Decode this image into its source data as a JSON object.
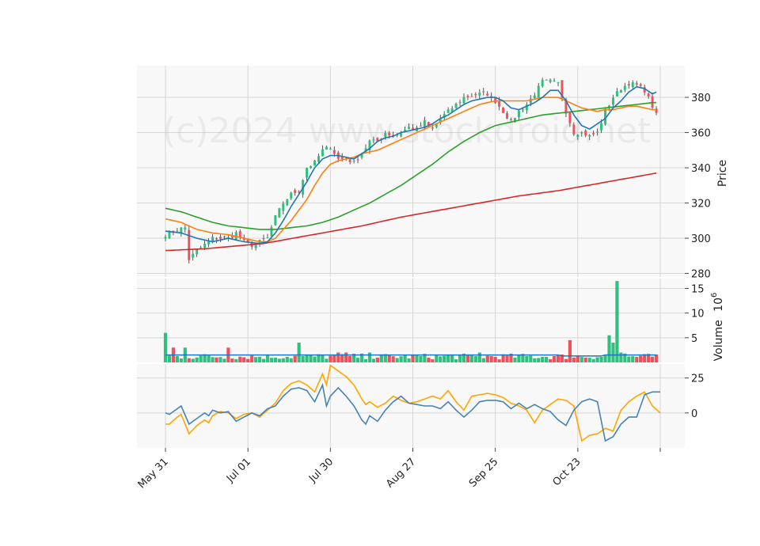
{
  "chart_data": {
    "type": "candlestick",
    "watermark": "(c)2024 www.stockdroid.net",
    "x_tick_labels": [
      "May 31",
      "Jul 01",
      "Jul 30",
      "Aug 27",
      "Sep 25",
      "Oct 23"
    ],
    "x_tick_index": [
      0,
      21,
      42,
      63,
      84,
      105,
      126
    ],
    "n_days": 126,
    "colors": {
      "up": "#26a69a",
      "up_fill": "#2fbf7f",
      "down": "#ef5350",
      "down_fill": "#f0505a",
      "ma_fast": "#1f77b4",
      "ma_mid": "#ff7f0e",
      "ma_slow": "#2ca02c",
      "ma_long": "#d62728",
      "osc_a": "#4682b4",
      "osc_b": "#ffa500"
    },
    "price_panel": {
      "ylabel": "Price",
      "ylim": [
        278,
        398
      ],
      "yticks": [
        280,
        300,
        320,
        340,
        360,
        380
      ],
      "ohlc_key": [
        [
          0,
          302
        ],
        [
          3,
          305
        ],
        [
          5,
          306
        ],
        [
          6,
          288
        ],
        [
          8,
          293
        ],
        [
          12,
          300
        ],
        [
          16,
          300
        ],
        [
          18,
          303
        ],
        [
          20,
          298
        ],
        [
          22,
          296
        ],
        [
          24,
          298
        ],
        [
          26,
          300
        ],
        [
          28,
          312
        ],
        [
          30,
          320
        ],
        [
          32,
          325
        ],
        [
          34,
          327
        ],
        [
          36,
          340
        ],
        [
          38,
          343
        ],
        [
          40,
          350
        ],
        [
          42,
          352
        ],
        [
          44,
          345
        ],
        [
          46,
          345
        ],
        [
          48,
          343
        ],
        [
          50,
          348
        ],
        [
          52,
          355
        ],
        [
          54,
          355
        ],
        [
          56,
          360
        ],
        [
          58,
          358
        ],
        [
          60,
          360
        ],
        [
          62,
          363
        ],
        [
          64,
          362
        ],
        [
          66,
          366
        ],
        [
          68,
          362
        ],
        [
          70,
          368
        ],
        [
          72,
          372
        ],
        [
          74,
          376
        ],
        [
          76,
          380
        ],
        [
          78,
          381
        ],
        [
          80,
          382
        ],
        [
          82,
          382
        ],
        [
          84,
          378
        ],
        [
          86,
          372
        ],
        [
          88,
          366
        ],
        [
          90,
          372
        ],
        [
          92,
          376
        ],
        [
          94,
          382
        ],
        [
          96,
          389
        ],
        [
          98,
          389
        ],
        [
          100,
          388
        ],
        [
          102,
          372
        ],
        [
          104,
          360
        ],
        [
          106,
          360
        ],
        [
          108,
          358
        ],
        [
          110,
          360
        ],
        [
          112,
          372
        ],
        [
          114,
          380
        ],
        [
          116,
          385
        ],
        [
          118,
          388
        ],
        [
          120,
          387
        ],
        [
          122,
          384
        ],
        [
          124,
          375
        ],
        [
          125,
          370
        ]
      ],
      "ma_fast_key": [
        [
          0,
          304
        ],
        [
          4,
          303
        ],
        [
          8,
          300
        ],
        [
          12,
          298
        ],
        [
          16,
          300
        ],
        [
          20,
          298
        ],
        [
          24,
          297
        ],
        [
          26,
          298
        ],
        [
          28,
          303
        ],
        [
          30,
          310
        ],
        [
          32,
          318
        ],
        [
          34,
          325
        ],
        [
          36,
          332
        ],
        [
          38,
          340
        ],
        [
          40,
          345
        ],
        [
          42,
          347
        ],
        [
          44,
          347
        ],
        [
          46,
          346
        ],
        [
          48,
          345
        ],
        [
          50,
          348
        ],
        [
          52,
          351
        ],
        [
          54,
          355
        ],
        [
          56,
          357
        ],
        [
          58,
          358
        ],
        [
          60,
          360
        ],
        [
          62,
          361
        ],
        [
          64,
          362
        ],
        [
          66,
          363
        ],
        [
          68,
          365
        ],
        [
          70,
          368
        ],
        [
          72,
          370
        ],
        [
          74,
          373
        ],
        [
          76,
          376
        ],
        [
          78,
          378
        ],
        [
          80,
          379
        ],
        [
          82,
          380
        ],
        [
          84,
          380
        ],
        [
          86,
          378
        ],
        [
          88,
          374
        ],
        [
          90,
          373
        ],
        [
          92,
          375
        ],
        [
          94,
          377
        ],
        [
          96,
          380
        ],
        [
          98,
          384
        ],
        [
          100,
          384
        ],
        [
          102,
          378
        ],
        [
          104,
          370
        ],
        [
          106,
          364
        ],
        [
          108,
          362
        ],
        [
          110,
          365
        ],
        [
          112,
          368
        ],
        [
          114,
          374
        ],
        [
          116,
          378
        ],
        [
          118,
          383
        ],
        [
          120,
          386
        ],
        [
          122,
          385
        ],
        [
          124,
          382
        ],
        [
          125,
          383
        ]
      ],
      "ma_mid_key": [
        [
          0,
          311
        ],
        [
          4,
          309
        ],
        [
          8,
          305
        ],
        [
          12,
          303
        ],
        [
          16,
          302
        ],
        [
          20,
          300
        ],
        [
          24,
          298
        ],
        [
          26,
          298
        ],
        [
          28,
          300
        ],
        [
          30,
          305
        ],
        [
          32,
          310
        ],
        [
          34,
          316
        ],
        [
          36,
          322
        ],
        [
          38,
          330
        ],
        [
          40,
          337
        ],
        [
          42,
          342
        ],
        [
          44,
          344
        ],
        [
          46,
          345
        ],
        [
          48,
          346
        ],
        [
          50,
          348
        ],
        [
          52,
          349
        ],
        [
          54,
          350
        ],
        [
          56,
          352
        ],
        [
          58,
          354
        ],
        [
          60,
          356
        ],
        [
          62,
          358
        ],
        [
          64,
          360
        ],
        [
          66,
          362
        ],
        [
          68,
          364
        ],
        [
          70,
          366
        ],
        [
          72,
          368
        ],
        [
          74,
          370
        ],
        [
          76,
          372
        ],
        [
          78,
          374
        ],
        [
          80,
          376
        ],
        [
          82,
          377
        ],
        [
          84,
          378
        ],
        [
          86,
          378
        ],
        [
          88,
          378
        ],
        [
          90,
          378
        ],
        [
          92,
          378
        ],
        [
          94,
          379
        ],
        [
          96,
          380
        ],
        [
          98,
          380
        ],
        [
          100,
          380
        ],
        [
          102,
          378
        ],
        [
          104,
          376
        ],
        [
          106,
          374
        ],
        [
          108,
          373
        ],
        [
          110,
          372
        ],
        [
          112,
          373
        ],
        [
          114,
          373
        ],
        [
          116,
          374
        ],
        [
          118,
          375
        ],
        [
          120,
          375
        ],
        [
          122,
          374
        ],
        [
          124,
          373
        ],
        [
          125,
          373
        ]
      ],
      "ma_slow_key": [
        [
          0,
          317
        ],
        [
          4,
          315
        ],
        [
          8,
          312
        ],
        [
          12,
          309
        ],
        [
          16,
          307
        ],
        [
          20,
          306
        ],
        [
          24,
          305
        ],
        [
          28,
          305
        ],
        [
          32,
          306
        ],
        [
          36,
          307
        ],
        [
          40,
          309
        ],
        [
          44,
          312
        ],
        [
          48,
          316
        ],
        [
          52,
          320
        ],
        [
          56,
          325
        ],
        [
          60,
          330
        ],
        [
          64,
          336
        ],
        [
          68,
          342
        ],
        [
          72,
          349
        ],
        [
          76,
          355
        ],
        [
          80,
          360
        ],
        [
          84,
          364
        ],
        [
          88,
          366
        ],
        [
          92,
          368
        ],
        [
          96,
          370
        ],
        [
          100,
          371
        ],
        [
          104,
          372
        ],
        [
          108,
          373
        ],
        [
          112,
          374
        ],
        [
          116,
          375
        ],
        [
          120,
          376
        ],
        [
          124,
          377
        ],
        [
          125,
          377
        ]
      ],
      "ma_long_key": [
        [
          0,
          293
        ],
        [
          10,
          294
        ],
        [
          20,
          296
        ],
        [
          25,
          297
        ],
        [
          30,
          299
        ],
        [
          40,
          303
        ],
        [
          50,
          307
        ],
        [
          60,
          312
        ],
        [
          70,
          316
        ],
        [
          80,
          320
        ],
        [
          90,
          324
        ],
        [
          100,
          327
        ],
        [
          110,
          331
        ],
        [
          120,
          335
        ],
        [
          125,
          337
        ]
      ]
    },
    "volume_panel": {
      "ylabel": "Volume",
      "ylabel_exponent": "10",
      "ylabel_exponent_power": "6",
      "ylim": [
        0,
        17
      ],
      "yticks": [
        5,
        10,
        15
      ],
      "line_level": 1.5,
      "spikes": [
        [
          0,
          6
        ],
        [
          2,
          3
        ],
        [
          5,
          3
        ],
        [
          16,
          3
        ],
        [
          34,
          4
        ],
        [
          44,
          2
        ],
        [
          46,
          2
        ],
        [
          52,
          2
        ],
        [
          80,
          2
        ],
        [
          103,
          4.5
        ],
        [
          113,
          5.5
        ],
        [
          114,
          4
        ],
        [
          115,
          16.5
        ],
        [
          116,
          2
        ],
        [
          117,
          1.8
        ]
      ]
    },
    "oscillator_panel": {
      "ylim": [
        -25,
        35
      ],
      "yticks": [
        0,
        25
      ],
      "series_a_key": [
        [
          0,
          0
        ],
        [
          1,
          -1
        ],
        [
          3,
          3
        ],
        [
          4,
          5
        ],
        [
          6,
          -8
        ],
        [
          8,
          -4
        ],
        [
          10,
          0
        ],
        [
          11,
          -2
        ],
        [
          12,
          2
        ],
        [
          14,
          0
        ],
        [
          16,
          1
        ],
        [
          18,
          -6
        ],
        [
          20,
          -3
        ],
        [
          22,
          0
        ],
        [
          24,
          -2
        ],
        [
          26,
          3
        ],
        [
          28,
          5
        ],
        [
          30,
          12
        ],
        [
          32,
          17
        ],
        [
          34,
          18
        ],
        [
          36,
          16
        ],
        [
          38,
          8
        ],
        [
          40,
          20
        ],
        [
          41,
          5
        ],
        [
          42,
          12
        ],
        [
          44,
          18
        ],
        [
          46,
          12
        ],
        [
          48,
          5
        ],
        [
          50,
          -5
        ],
        [
          51,
          -8
        ],
        [
          52,
          -2
        ],
        [
          54,
          -6
        ],
        [
          56,
          2
        ],
        [
          58,
          8
        ],
        [
          60,
          12
        ],
        [
          62,
          7
        ],
        [
          64,
          6
        ],
        [
          66,
          5
        ],
        [
          68,
          5
        ],
        [
          70,
          3
        ],
        [
          72,
          8
        ],
        [
          74,
          2
        ],
        [
          76,
          -3
        ],
        [
          78,
          2
        ],
        [
          80,
          8
        ],
        [
          82,
          9
        ],
        [
          84,
          9
        ],
        [
          86,
          8
        ],
        [
          88,
          3
        ],
        [
          90,
          7
        ],
        [
          92,
          3
        ],
        [
          94,
          6
        ],
        [
          96,
          3
        ],
        [
          98,
          1
        ],
        [
          100,
          -5
        ],
        [
          102,
          -9
        ],
        [
          104,
          2
        ],
        [
          106,
          8
        ],
        [
          108,
          10
        ],
        [
          110,
          8
        ],
        [
          112,
          -20
        ],
        [
          114,
          -17
        ],
        [
          116,
          -8
        ],
        [
          118,
          -3
        ],
        [
          120,
          -3
        ],
        [
          122,
          13
        ],
        [
          124,
          15
        ],
        [
          126,
          15
        ]
      ],
      "series_b_key": [
        [
          0,
          -8
        ],
        [
          1,
          -8
        ],
        [
          3,
          -3
        ],
        [
          4,
          -1
        ],
        [
          6,
          -15
        ],
        [
          8,
          -9
        ],
        [
          10,
          -5
        ],
        [
          11,
          -7
        ],
        [
          12,
          -2
        ],
        [
          14,
          1
        ],
        [
          16,
          0
        ],
        [
          18,
          -4
        ],
        [
          20,
          -1
        ],
        [
          22,
          0
        ],
        [
          24,
          -3
        ],
        [
          26,
          2
        ],
        [
          28,
          7
        ],
        [
          30,
          16
        ],
        [
          32,
          21
        ],
        [
          34,
          23
        ],
        [
          36,
          20
        ],
        [
          38,
          15
        ],
        [
          40,
          28
        ],
        [
          41,
          20
        ],
        [
          42,
          34
        ],
        [
          44,
          30
        ],
        [
          46,
          26
        ],
        [
          48,
          20
        ],
        [
          50,
          10
        ],
        [
          51,
          6
        ],
        [
          52,
          8
        ],
        [
          54,
          4
        ],
        [
          56,
          7
        ],
        [
          58,
          12
        ],
        [
          60,
          9
        ],
        [
          62,
          7
        ],
        [
          64,
          8
        ],
        [
          66,
          10
        ],
        [
          68,
          12
        ],
        [
          70,
          10
        ],
        [
          72,
          16
        ],
        [
          74,
          8
        ],
        [
          76,
          2
        ],
        [
          78,
          12
        ],
        [
          80,
          13
        ],
        [
          82,
          14
        ],
        [
          84,
          13
        ],
        [
          86,
          11
        ],
        [
          88,
          7
        ],
        [
          90,
          5
        ],
        [
          92,
          2
        ],
        [
          94,
          -7
        ],
        [
          96,
          2
        ],
        [
          98,
          6
        ],
        [
          100,
          10
        ],
        [
          102,
          9
        ],
        [
          104,
          5
        ],
        [
          106,
          -20
        ],
        [
          108,
          -16
        ],
        [
          110,
          -15
        ],
        [
          112,
          -11
        ],
        [
          114,
          -13
        ],
        [
          116,
          2
        ],
        [
          118,
          8
        ],
        [
          120,
          12
        ],
        [
          122,
          15
        ],
        [
          124,
          5
        ],
        [
          126,
          0
        ]
      ]
    }
  }
}
